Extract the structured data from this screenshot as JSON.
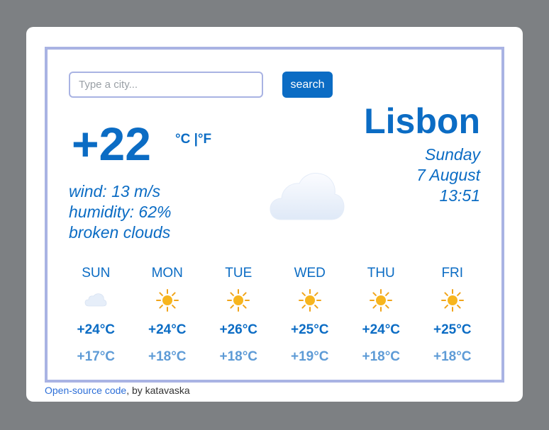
{
  "search": {
    "placeholder": "Type a city...",
    "button_label": "search"
  },
  "current": {
    "temperature": "+22",
    "units": "°C |°F",
    "wind": "wind: 13 m/s",
    "humidity": "humidity: 62%",
    "description": "broken clouds",
    "icon": "cloud-icon"
  },
  "location": {
    "city": "Lisbon",
    "weekday": "Sunday",
    "date": "7 August",
    "time": "13:51"
  },
  "forecast": [
    {
      "day": "SUN",
      "icon": "cloud-icon",
      "high": "+24°C",
      "low": "+17°C"
    },
    {
      "day": "MON",
      "icon": "sun-icon",
      "high": "+24°C",
      "low": "+18°C"
    },
    {
      "day": "TUE",
      "icon": "sun-icon",
      "high": "+26°C",
      "low": "+18°C"
    },
    {
      "day": "WED",
      "icon": "sun-icon",
      "high": "+25°C",
      "low": "+19°C"
    },
    {
      "day": "THU",
      "icon": "sun-icon",
      "high": "+24°C",
      "low": "+18°C"
    },
    {
      "day": "FRI",
      "icon": "sun-icon",
      "high": "+25°C",
      "low": "+18°C"
    }
  ],
  "footer": {
    "link_text": "Open-source code",
    "suffix": ", by katavaska"
  },
  "colors": {
    "accent": "#0b6cc4",
    "frame": "#a9b3e3",
    "low_temp": "#5e9bd6",
    "background": "#7d8083"
  }
}
